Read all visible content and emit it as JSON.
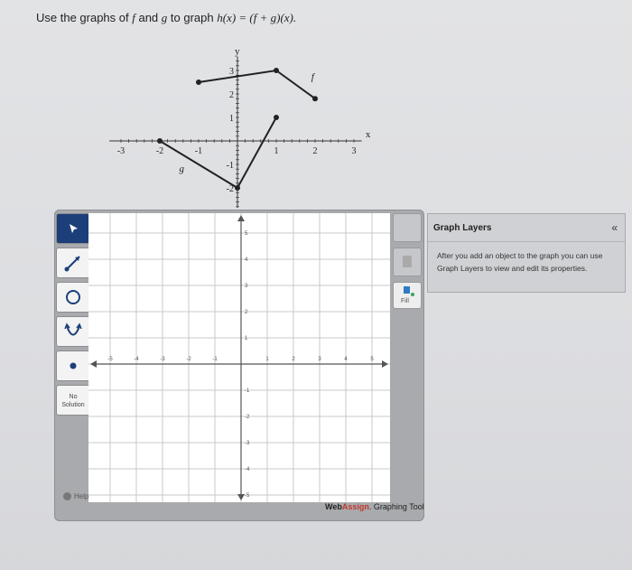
{
  "question": {
    "prefix": "Use the graphs of ",
    "f": "f",
    "mid": " and ",
    "g": "g",
    "suffix": " to graph ",
    "formula": "h(x) = (f + g)(x)."
  },
  "reference_graph": {
    "x_axis_label": "x",
    "y_axis_label": "y",
    "x_ticks": [
      "-3",
      "-2",
      "-1",
      "1",
      "2",
      "3"
    ],
    "y_ticks": [
      "3",
      "2",
      "1",
      "-1",
      "-2",
      "-3"
    ],
    "f_label": "f",
    "g_label": "g",
    "f_points": [
      [
        -1,
        2.5
      ],
      [
        1,
        3
      ],
      [
        2,
        1.8
      ]
    ],
    "g_points": [
      [
        -2,
        0
      ],
      [
        0,
        -2
      ],
      [
        1,
        1
      ]
    ]
  },
  "plot": {
    "x_ticks": [
      "-5",
      "-4",
      "-3",
      "-2",
      "-1",
      "1",
      "2",
      "3",
      "4",
      "5"
    ],
    "y_ticks": [
      "5",
      "4",
      "3",
      "2",
      "1",
      "-1",
      "-2",
      "-3",
      "-4",
      "-5"
    ]
  },
  "toolbar": {
    "no_solution_label": "No Solution",
    "help_label": "Help"
  },
  "right_panel": {
    "fill_label": "Fill"
  },
  "brand": {
    "web": "Web",
    "assign": "Assign",
    "suffix": ". Graphing Tool"
  },
  "layers": {
    "title": "Graph Layers",
    "collapse": "«",
    "body": "After you add an object to the graph you can use Graph Layers to view and edit its properties."
  }
}
